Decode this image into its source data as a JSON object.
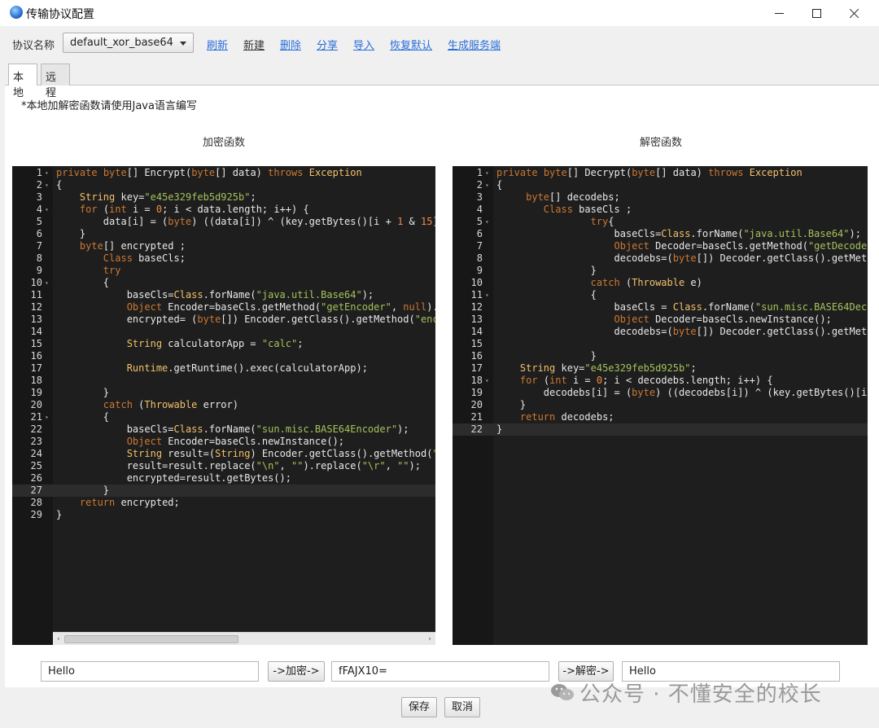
{
  "window": {
    "title": "传输协议配置"
  },
  "toolbar": {
    "protocol_label": "协议名称",
    "protocol_selected": "default_xor_base64",
    "links": [
      "刷新",
      "新建",
      "删除",
      "分享",
      "导入",
      "恢复默认",
      "生成服务端"
    ]
  },
  "tabs": [
    "本地",
    "远程"
  ],
  "note": "*本地加解密函数请使用Java语言编写",
  "encrypt": {
    "title": "加密函数",
    "line_numbers": [
      "1",
      "2",
      "3",
      "4",
      "5",
      "6",
      "7",
      "8",
      "9",
      "10",
      "11",
      "12",
      "13",
      "14",
      "15",
      "16",
      "17",
      "18",
      "19",
      "20",
      "21",
      "22",
      "23",
      "24",
      "25",
      "26",
      "27",
      "28",
      "29"
    ]
  },
  "decrypt": {
    "title": "解密函数",
    "line_numbers": [
      "1",
      "2",
      "3",
      "4",
      "5",
      "6",
      "7",
      "8",
      "9",
      "10",
      "11",
      "12",
      "13",
      "14",
      "15",
      "16",
      "17",
      "18",
      "19",
      "20",
      "21",
      "22"
    ]
  },
  "bottom": {
    "plain_input": "Hello",
    "encrypt_button": "->加密->",
    "cipher_output": "fFAJX10=",
    "decrypt_button": "->解密->",
    "decrypt_output": "Hello",
    "save_button": "保存",
    "cancel_button": "取消"
  },
  "watermark": "公众号 · 不懂安全的校长",
  "colors": {
    "editor_bg": "#1e1e1e",
    "keyword": "#cc7832",
    "string": "#a5c25c",
    "number": "#f08d49",
    "class": "#f3c16b",
    "link": "#2a6ed8"
  }
}
